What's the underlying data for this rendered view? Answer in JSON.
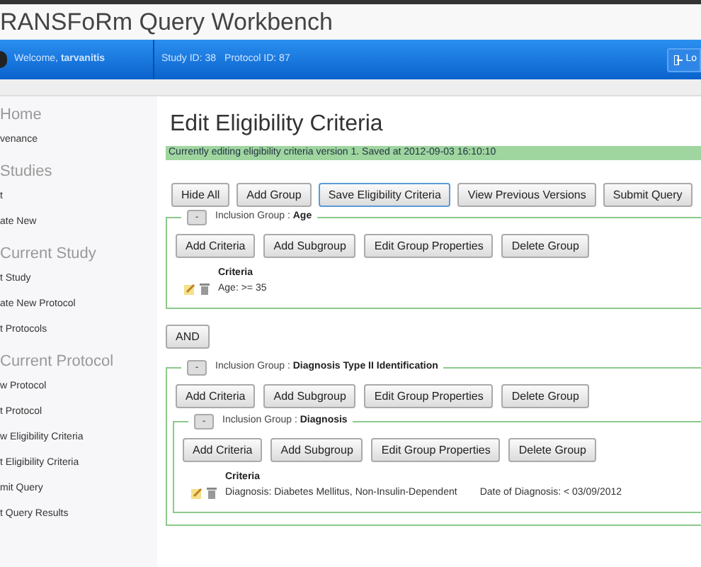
{
  "app_title": "RANSFoRm Query Workbench",
  "header": {
    "welcome": "Welcome, **tarvanitis**",
    "study": "Study ID: 38",
    "protocol": "Protocol ID: 87",
    "logout": "Lo"
  },
  "sidebar": [
    {
      "heading": "Home",
      "items": [
        "venance"
      ]
    },
    {
      "heading": "Studies",
      "items": [
        "t",
        "ate New"
      ]
    },
    {
      "heading": "Current Study",
      "items": [
        "t Study",
        "ate New Protocol",
        "t Protocols"
      ]
    },
    {
      "heading": "Current Protocol",
      "items": [
        "w Protocol",
        "t Protocol",
        "w Eligibility Criteria",
        "t Eligibility Criteria",
        "mit Query",
        "t Query Results"
      ]
    }
  ],
  "page_title": "Edit Eligibility Criteria",
  "status_message": "Currently editing eligibility criteria version 1. Saved at 2012-09-03 16:10:10",
  "toolbar": [
    {
      "label": "Hide All",
      "focused": false
    },
    {
      "label": "Add Group",
      "focused": false
    },
    {
      "label": "Save Eligibility Criteria",
      "focused": true
    },
    {
      "label": "View Previous Versions",
      "focused": false
    },
    {
      "label": "Submit Query",
      "focused": false
    }
  ],
  "criteria_tree": [
    {
      "kind": "group",
      "toggle": "-",
      "prefix": "Inclusion Group : ",
      "name": "Age",
      "actions": [
        "Add Criteria",
        "Add Subgroup",
        "Edit Group Properties",
        "Delete Group"
      ],
      "criteria_heading": "Criteria",
      "criteria": [
        [
          "Age: >= 35"
        ]
      ]
    },
    {
      "kind": "operator",
      "label": "AND"
    },
    {
      "kind": "group",
      "toggle": "-",
      "prefix": "Inclusion Group : ",
      "name": "Diagnosis Type II Identification",
      "actions": [
        "Add Criteria",
        "Add Subgroup",
        "Edit Group Properties",
        "Delete Group"
      ],
      "children": [
        {
          "kind": "group",
          "toggle": "-",
          "prefix": "Inclusion Group : ",
          "name": "Diagnosis",
          "actions": [
            "Add Criteria",
            "Add Subgroup",
            "Edit Group Properties",
            "Delete Group"
          ],
          "criteria_heading": "Criteria",
          "criteria": [
            [
              "Diagnosis: Diabetes Mellitus, Non-Insulin-Dependent",
              "Date of Diagnosis: < 03/09/2012"
            ]
          ]
        }
      ]
    }
  ]
}
